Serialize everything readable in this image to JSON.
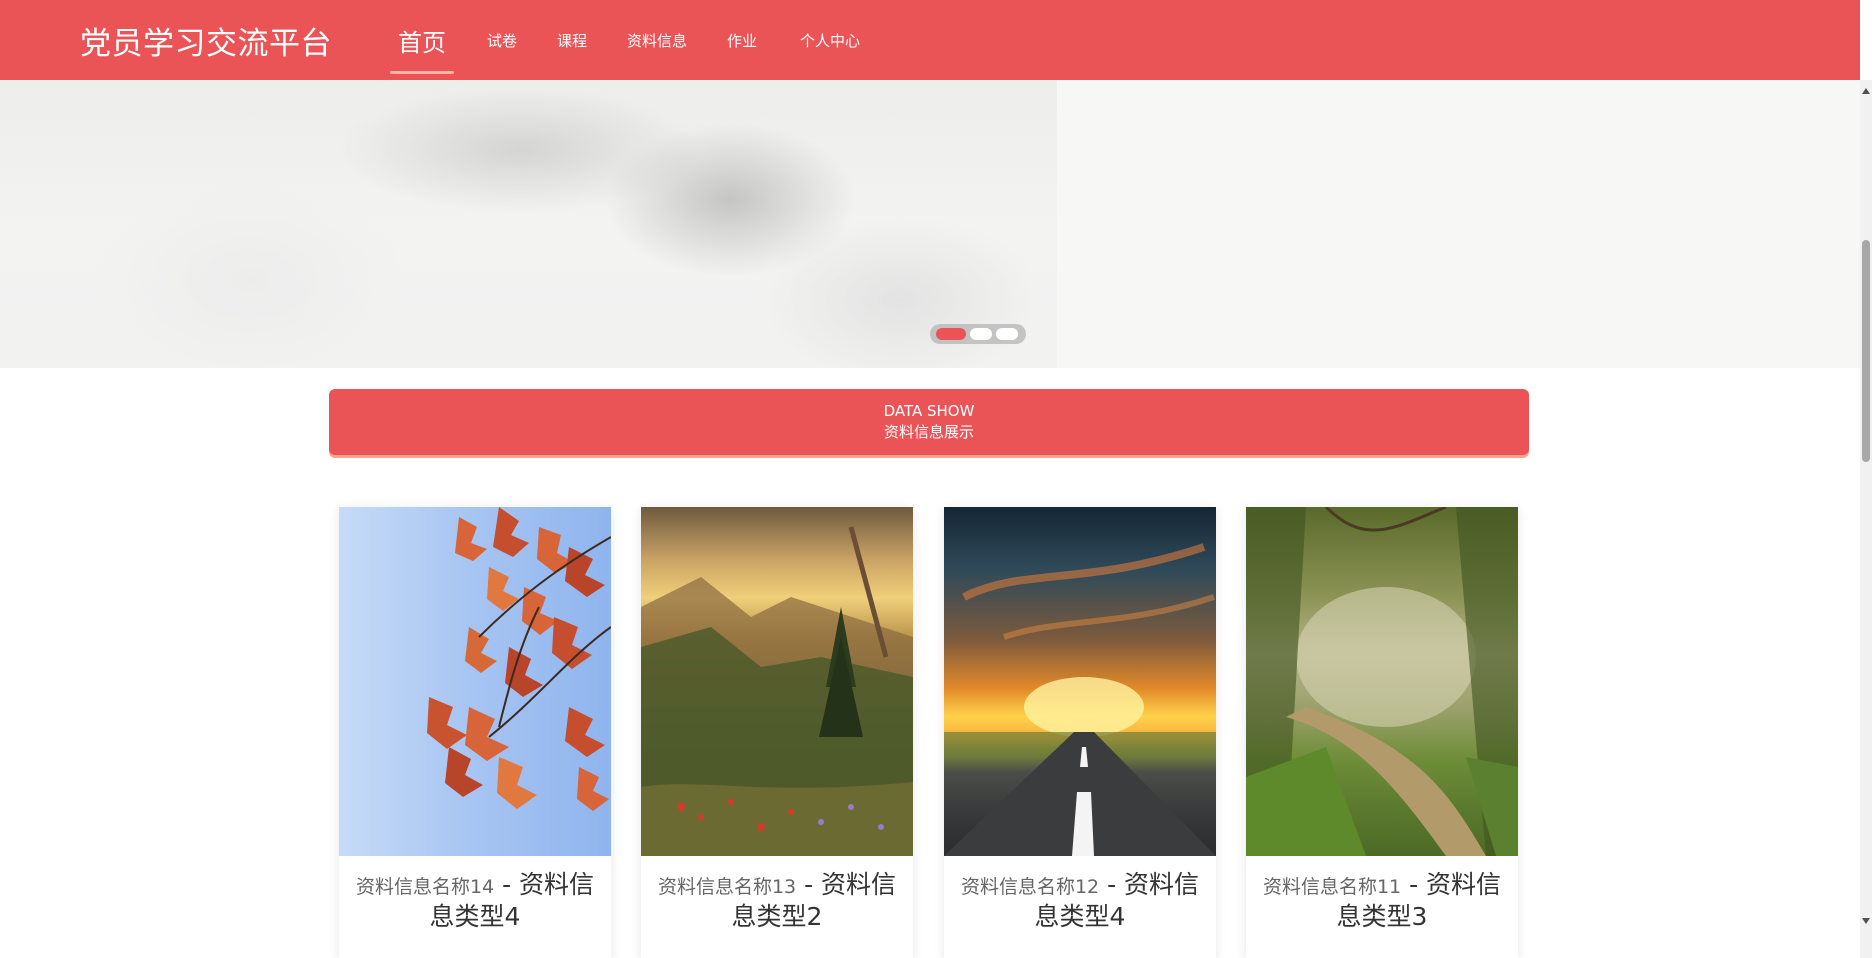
{
  "header": {
    "logo": "党员学习交流平台",
    "nav": [
      {
        "label": "首页",
        "active": true
      },
      {
        "label": "试卷"
      },
      {
        "label": "课程"
      },
      {
        "label": "资料信息"
      },
      {
        "label": "作业"
      },
      {
        "label": "个人中心"
      }
    ]
  },
  "banner": {
    "slides_count": 3,
    "active_slide": 1
  },
  "showbar": {
    "title_en": "DATA SHOW",
    "title_cn": "资料信息展示"
  },
  "cards": [
    {
      "name": "资料信息名称14",
      "sep": " - ",
      "type": "资料信息类型4",
      "image": "autumn-leaves-photo"
    },
    {
      "name": "资料信息名称13",
      "sep": " - ",
      "type": "资料信息类型2",
      "image": "mountain-valley-photo"
    },
    {
      "name": "资料信息名称12",
      "sep": " - ",
      "type": "资料信息类型4",
      "image": "sunset-road-photo"
    },
    {
      "name": "资料信息名称11",
      "sep": " - ",
      "type": "资料信息类型3",
      "image": "forest-path-photo"
    }
  ],
  "colors": {
    "primary": "#eb5457",
    "underline": "#ffb3a6",
    "banner_bg": "#f7f7f6"
  }
}
